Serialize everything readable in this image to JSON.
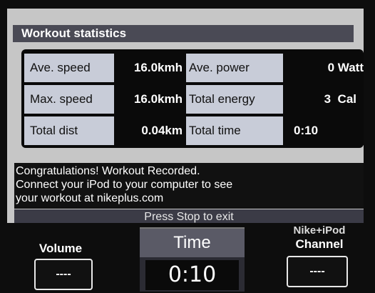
{
  "header": {
    "title": "Workout statistics"
  },
  "stats": [
    {
      "label": "Ave. speed",
      "value": "16.0kmh",
      "label2": "Ave. power",
      "value2": "0 Watt"
    },
    {
      "label": "Max. speed",
      "value": "16.0kmh",
      "label2": "Total energy",
      "value2": "3  Cal"
    },
    {
      "label": "Total dist",
      "value": "0.04km",
      "label2": "Total time",
      "value2": "0:10"
    }
  ],
  "message": {
    "line1": "Congratulations! Workout Recorded.",
    "line2": "Connect your iPod to your computer to see",
    "line3": "your workout at nikeplus.com"
  },
  "exit_hint": "Press Stop to exit",
  "controls": {
    "volume": {
      "label": "Volume",
      "value": "----"
    },
    "time": {
      "label": "Time",
      "value": "0:10"
    },
    "channel": {
      "brand": "Nike+iPod",
      "label": "Channel",
      "value": "----"
    }
  },
  "colors": {
    "panel": "#c6c6c6",
    "title_bar": "#4a4a55",
    "label_cell": "#c8ccd8",
    "value_cell": "#0a0a0a"
  }
}
